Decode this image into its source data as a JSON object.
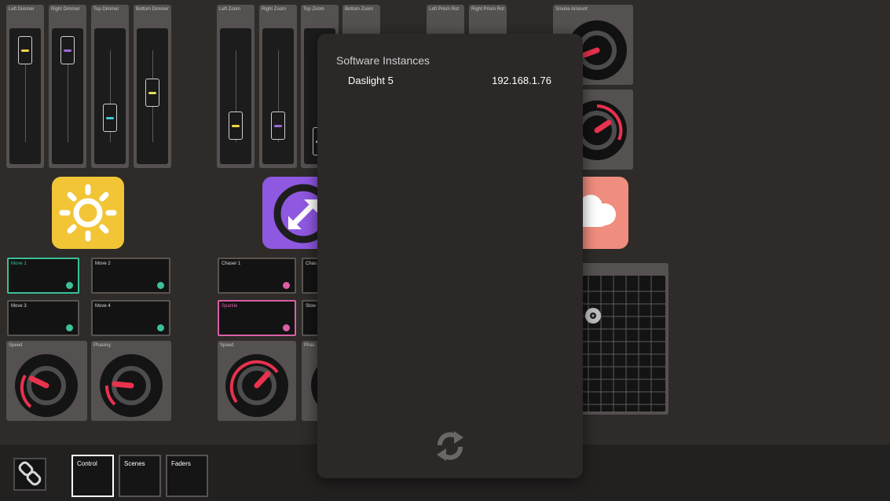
{
  "faders": [
    {
      "label": "Left Dimmer",
      "accent": "#f1d44a",
      "level": 0.9
    },
    {
      "label": "Right Dimmer",
      "accent": "#9b6ad8",
      "level": 0.9
    },
    {
      "label": "Top Dimmer",
      "accent": "#43c8d8",
      "level": 0.25
    },
    {
      "label": "Bottom Dimmer",
      "accent": "#e0e057",
      "level": 0.6
    },
    {
      "label": "Left Zoom",
      "accent": "#f1d44a",
      "level": 0.15
    },
    {
      "label": "Right Zoom",
      "accent": "#9b6ad8",
      "level": 0.15
    },
    {
      "label": "Top Zoom",
      "accent": "#cccccc",
      "level": 0.1
    },
    {
      "label": "Bottom Zoom"
    }
  ],
  "prism_labels": [
    "Left Prism Rot",
    "Right Prism Rot"
  ],
  "smoke": {
    "label": "Smoke Amount"
  },
  "icons": {
    "sun": "sun-icon",
    "zoom": "zoom-icon",
    "cloud": "cloud-icon"
  },
  "colors": {
    "sun_bg": "#f1c536",
    "zoom_bg": "#8f58e0",
    "cloud_bg": "#ef8d7f",
    "move_accent": "#3cbf9a",
    "chase_accent": "#d95fa6",
    "dial_accent": "#e8324e"
  },
  "movement": {
    "tiles": [
      {
        "label": "Move 1",
        "selected": true
      },
      {
        "label": "Move 2",
        "selected": false
      },
      {
        "label": "Move 3",
        "selected": false
      },
      {
        "label": "Move 4",
        "selected": false
      }
    ],
    "dials": [
      {
        "label": "Speed"
      },
      {
        "label": "Phasing"
      }
    ]
  },
  "effects": {
    "tiles": [
      {
        "label": "Chaser 1",
        "selected": false
      },
      {
        "label": "Chas",
        "selected": false
      },
      {
        "label": "Sparkle",
        "selected": true
      },
      {
        "label": "Slow",
        "selected": false
      }
    ],
    "dials": [
      {
        "label": "Speed"
      },
      {
        "label": "Phas"
      }
    ]
  },
  "popover": {
    "title": "Software Instances",
    "instances": [
      {
        "name": "Daslight 5",
        "ip": "192.168.1.76"
      }
    ],
    "refresh_icon": "refresh-icon"
  },
  "bottom_bar": {
    "link_icon": "link-icon",
    "nav": [
      {
        "label": "Control",
        "active": true
      },
      {
        "label": "Scenes",
        "active": false
      },
      {
        "label": "Faders",
        "active": false
      }
    ]
  }
}
